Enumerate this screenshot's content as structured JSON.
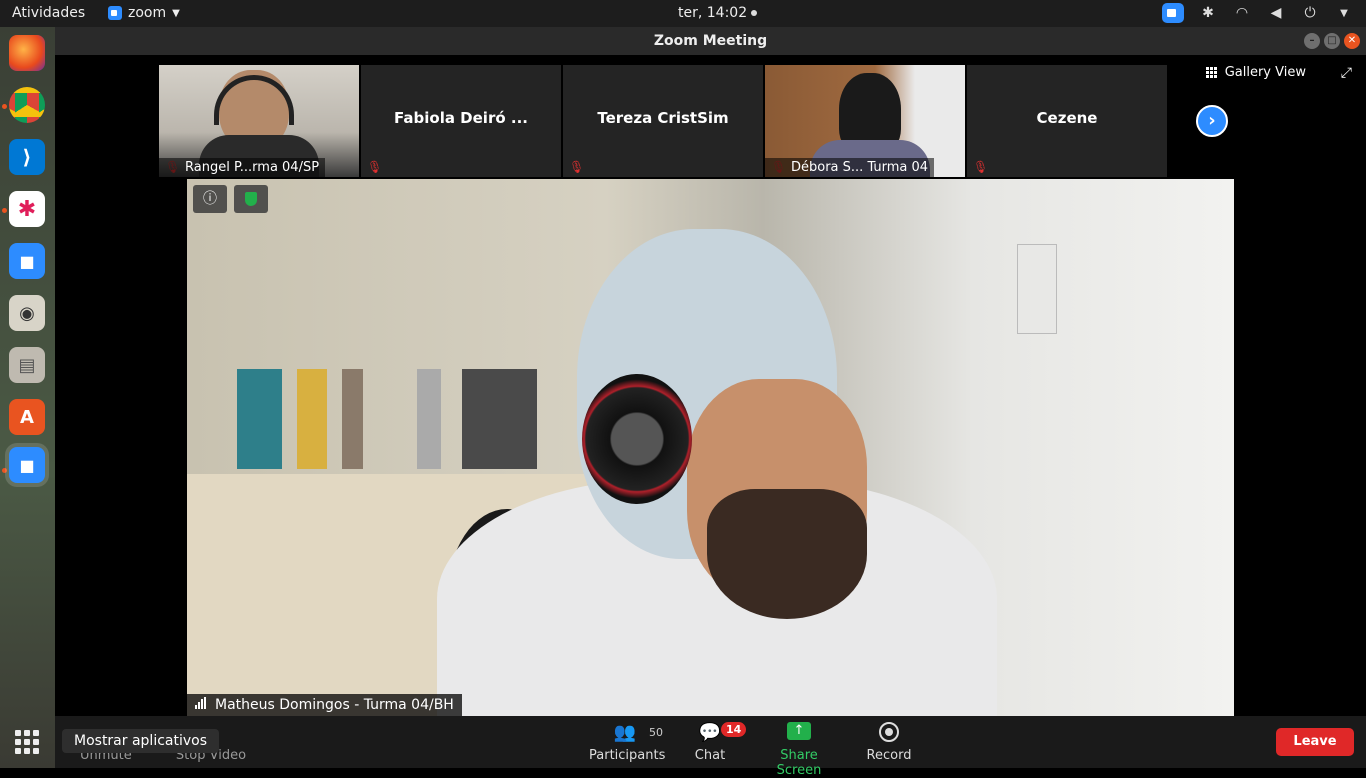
{
  "topbar": {
    "activities": "Atividades",
    "app_name": "zoom",
    "clock": "ter, 14:02"
  },
  "window": {
    "title": "Zoom Meeting"
  },
  "gallery": {
    "view_label": "Gallery View",
    "thumbs": [
      {
        "label": "Rangel P...rma 04/SP",
        "has_video": true
      },
      {
        "name": "Fabiola Deiró ...",
        "has_video": false
      },
      {
        "name": "Tereza CristSim",
        "has_video": false
      },
      {
        "label": "Débora S... Turma 04",
        "has_video": true
      },
      {
        "name": "Cezene",
        "has_video": false
      }
    ]
  },
  "main": {
    "speaker": "Matheus Domingos - Turma 04/BH"
  },
  "toolbar": {
    "unmute": "Unmute",
    "stop_video": "Stop Video",
    "participants": "Participants",
    "participants_count": "50",
    "chat": "Chat",
    "chat_badge": "14",
    "share_screen": "Share Screen",
    "record": "Record",
    "leave": "Leave"
  },
  "dock": {
    "tooltip": "Mostrar aplicativos"
  }
}
